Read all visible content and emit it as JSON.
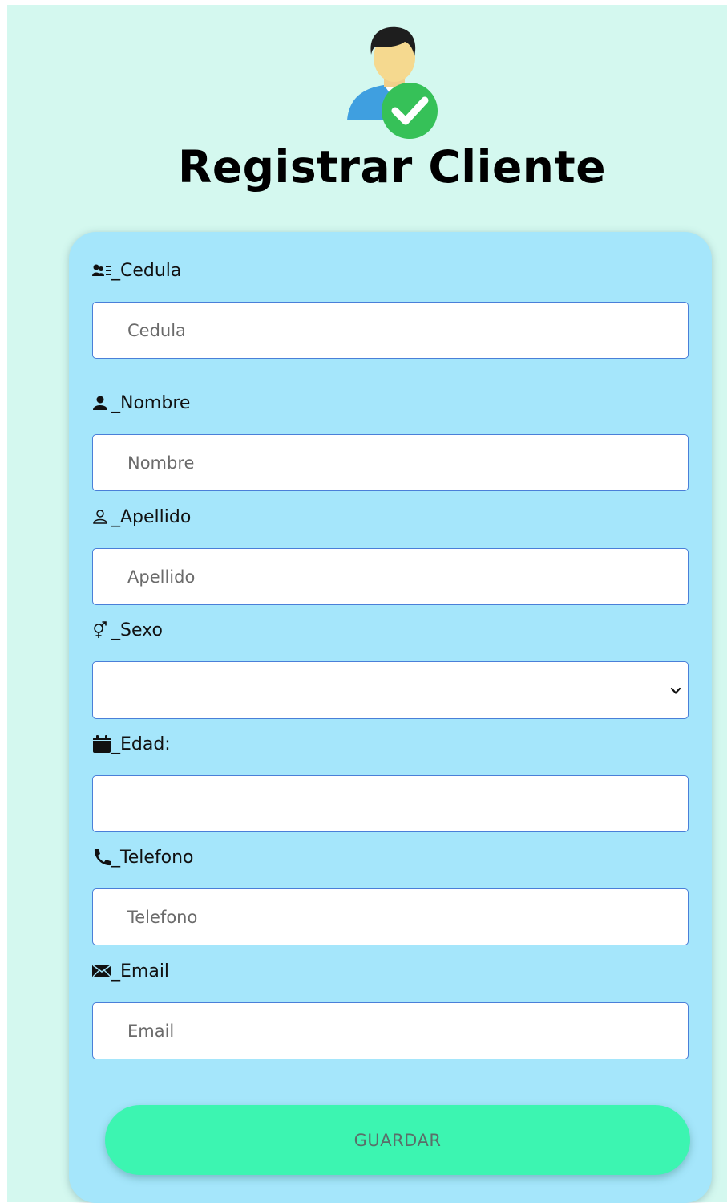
{
  "header": {
    "title": "Registrar Cliente",
    "avatar_icon": "user-check-icon"
  },
  "form": {
    "fields": [
      {
        "label": "_Cedula",
        "icon": "id-card-icon",
        "placeholder": "Cedula",
        "value": ""
      },
      {
        "label": "_Nombre",
        "icon": "user-icon",
        "placeholder": "Nombre",
        "value": ""
      },
      {
        "label": "_Apellido",
        "icon": "user-outline-icon",
        "placeholder": "Apellido",
        "value": ""
      },
      {
        "label": "_Sexo",
        "icon": "gender-icon",
        "selected": ""
      },
      {
        "label": "_Edad:",
        "icon": "calendar-icon",
        "placeholder": "",
        "value": ""
      },
      {
        "label": "_Telefono",
        "icon": "phone-icon",
        "placeholder": "Telefono",
        "value": ""
      },
      {
        "label": "_Email",
        "icon": "envelope-icon",
        "placeholder": "Email",
        "value": ""
      }
    ],
    "save_label": "GUARDAR"
  },
  "colors": {
    "page_background": "#d4f8ef",
    "card_background": "#a5e6fb",
    "input_border": "#4a7fd8",
    "button_background": "#3cf5b1",
    "button_text": "#5a6f6a"
  }
}
